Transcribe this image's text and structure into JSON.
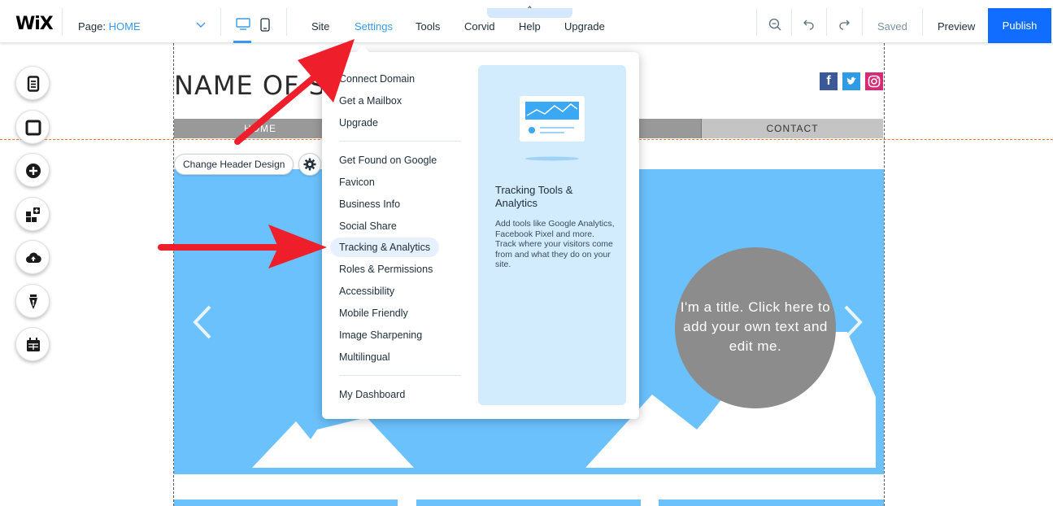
{
  "topbar": {
    "logo": "WiX",
    "page_label": "Page:",
    "page_value": "HOME",
    "menu": [
      "Site",
      "Settings",
      "Tools",
      "Corvid",
      "Help",
      "Upgrade"
    ],
    "active_menu": "Settings",
    "tab_handle": "⌃",
    "saved": "Saved",
    "preview": "Preview",
    "publish": "Publish",
    "colors": {
      "accent": "#3899ec",
      "publish": "#116dff"
    }
  },
  "site": {
    "title": "NAME OF SI",
    "nav": {
      "home": "HOME",
      "contact": "CONTACT"
    },
    "change_header": "Change Header Design",
    "slide_text": "I'm a title. Click here to add your own text and edit me.",
    "colors": {
      "slide_bg": "#6bc1fc",
      "circle": "#8c8c8c"
    }
  },
  "left_toolbar": [
    "pages-icon",
    "background-icon",
    "add-icon",
    "add-apps-icon",
    "upload-icon",
    "blog-icon",
    "bookings-icon"
  ],
  "settings_menu": {
    "group1": [
      "Connect Domain",
      "Get a Mailbox",
      "Upgrade"
    ],
    "group2": [
      "Get Found on Google",
      "Favicon",
      "Business Info",
      "Social Share",
      "Tracking & Analytics",
      "Roles & Permissions",
      "Accessibility",
      "Mobile Friendly",
      "Image Sharpening",
      "Multilingual"
    ],
    "group3": [
      "My Dashboard"
    ],
    "highlighted": "Tracking & Analytics",
    "panel": {
      "title": "Tracking Tools & Analytics",
      "description": "Add tools like Google Analytics, Facebook Pixel and more. Track where your visitors come from and what they do on your site."
    }
  }
}
